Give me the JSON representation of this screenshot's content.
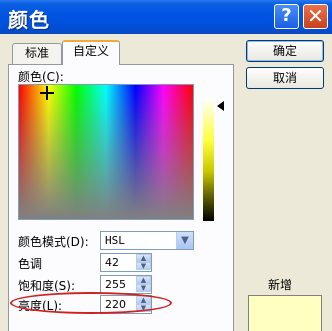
{
  "window": {
    "title": "颜色",
    "help_label": "?",
    "close_label": "✕"
  },
  "tabs": [
    {
      "label": "标准"
    },
    {
      "label": "自定义"
    }
  ],
  "custom": {
    "colors_label": "颜色(C):",
    "color_model_label": "颜色模式(D):",
    "color_model_value": "HSL",
    "fields": [
      {
        "label": "色调",
        "value": "42"
      },
      {
        "label": "饱和度(S):",
        "value": "255"
      },
      {
        "label": "亮度(L):",
        "value": "220"
      }
    ]
  },
  "buttons": {
    "ok": "确定",
    "cancel": "取消"
  },
  "preview": {
    "new_label": "新增",
    "color": "#ffffc0"
  }
}
